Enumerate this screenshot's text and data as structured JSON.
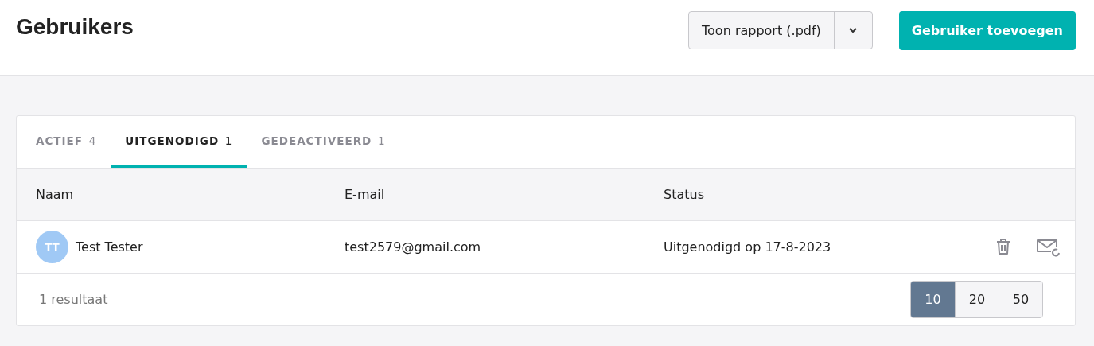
{
  "page_title": "Gebruikers",
  "report_button": {
    "label": "Toon rapport (.pdf)"
  },
  "add_button": {
    "label": "Gebruiker toevoegen"
  },
  "tabs": [
    {
      "label": "ACTIEF",
      "count": "4",
      "selected": false
    },
    {
      "label": "UITGENODIGD",
      "count": "1",
      "selected": true
    },
    {
      "label": "GEDEACTIVEERD",
      "count": "1",
      "selected": false
    }
  ],
  "table": {
    "columns": [
      "Naam",
      "E-mail",
      "Status"
    ],
    "rows": [
      {
        "initials": "TT",
        "name": "Test Tester",
        "email": "test2579@gmail.com",
        "status": "Uitgenodigd op 17-8-2023"
      }
    ]
  },
  "result_count": "1 resultaat",
  "page_sizes": [
    {
      "label": "10",
      "selected": true
    },
    {
      "label": "20",
      "selected": false
    },
    {
      "label": "50",
      "selected": false
    }
  ]
}
